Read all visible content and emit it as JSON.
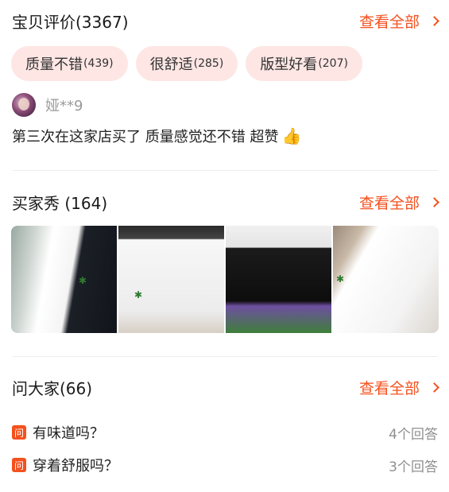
{
  "reviews": {
    "title": "宝贝评价(3367)",
    "view_all": "查看全部",
    "tags": [
      {
        "label": "质量不错",
        "count": "(439)"
      },
      {
        "label": "很舒适",
        "count": "(285)"
      },
      {
        "label": "版型好看",
        "count": "(207)"
      }
    ],
    "first_review": {
      "user": "娅**9",
      "text": "第三次在这家店买了  质量感觉还不错  超赞",
      "emoji": "👍"
    }
  },
  "buyer_show": {
    "title": "买家秀 (164)",
    "view_all": "查看全部",
    "photo_count_shown": 4
  },
  "qa": {
    "title": "问大家(66)",
    "view_all": "查看全部",
    "badge": "问",
    "items": [
      {
        "question": "有味道吗？",
        "answers": "4个回答"
      },
      {
        "question": "穿着舒服吗？",
        "answers": "3个回答"
      }
    ]
  },
  "colors": {
    "accent": "#f4511e",
    "tag_bg": "#fde6e4"
  }
}
